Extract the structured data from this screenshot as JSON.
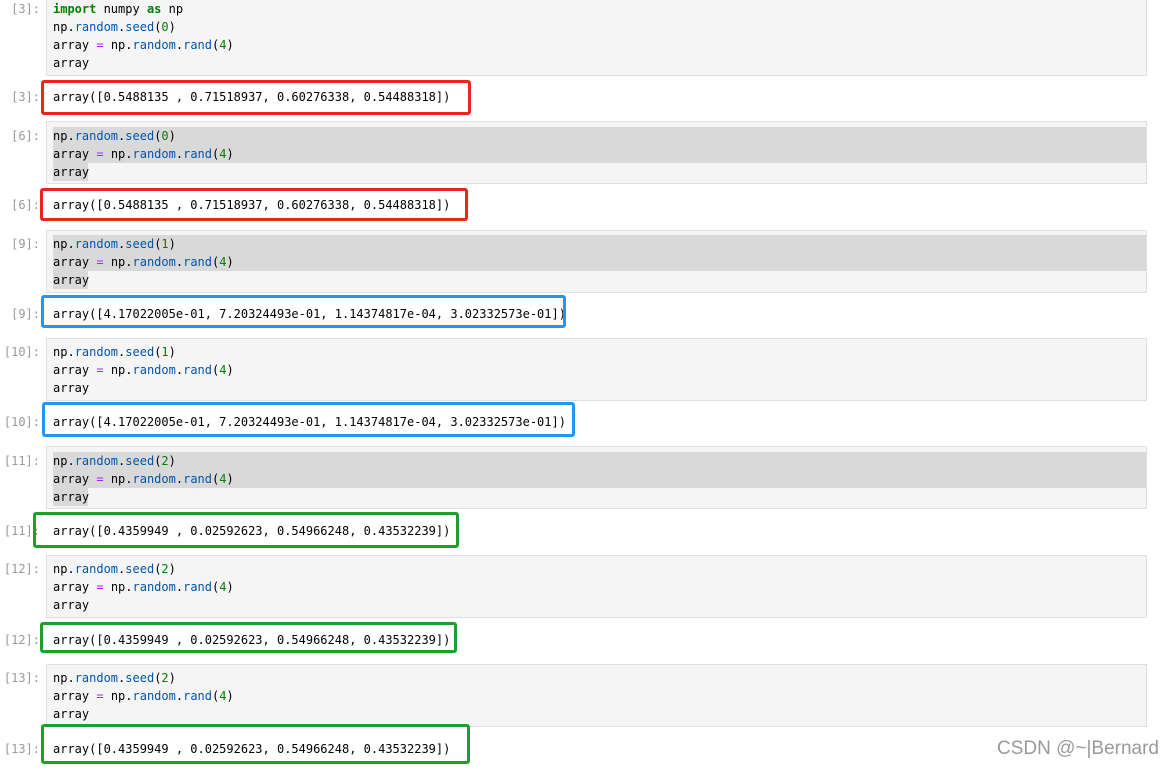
{
  "cells": [
    {
      "in_prompt": "[3]:",
      "out_prompt": "[3]:",
      "lines": [
        "import numpy as np",
        "np.random.seed(0)",
        "array = np.random.rand(4)",
        "array"
      ],
      "output": "array([0.5488135 , 0.71518937, 0.60276338, 0.54488318])",
      "frame_color": "#e8261c"
    },
    {
      "in_prompt": "[6]:",
      "out_prompt": "[6]:",
      "lines": [
        "np.random.seed(0)",
        "array = np.random.rand(4)",
        "array"
      ],
      "output": "array([0.5488135 , 0.71518937, 0.60276338, 0.54488318])",
      "frame_color": "#e8261c"
    },
    {
      "in_prompt": "[9]:",
      "out_prompt": "[9]:",
      "lines": [
        "np.random.seed(1)",
        "array = np.random.rand(4)",
        "array"
      ],
      "output": "array([4.17022005e-01, 7.20324493e-01, 1.14374817e-04, 3.02332573e-01])",
      "frame_color": "#2196f3"
    },
    {
      "in_prompt": "[10]:",
      "out_prompt": "[10]:",
      "lines": [
        "np.random.seed(1)",
        "array = np.random.rand(4)",
        "array"
      ],
      "output": "array([4.17022005e-01, 7.20324493e-01, 1.14374817e-04, 3.02332573e-01])",
      "frame_color": "#2196f3"
    },
    {
      "in_prompt": "[11]:",
      "out_prompt": "[11]:",
      "lines": [
        "np.random.seed(2)",
        "array = np.random.rand(4)",
        "array"
      ],
      "output": "array([0.4359949 , 0.02592623, 0.54966248, 0.43532239])",
      "frame_color": "#1ea12b"
    },
    {
      "in_prompt": "[12]:",
      "out_prompt": "[12]:",
      "lines": [
        "np.random.seed(2)",
        "array = np.random.rand(4)",
        "array"
      ],
      "output": "array([0.4359949 , 0.02592623, 0.54966248, 0.43532239])",
      "frame_color": "#1ea12b"
    },
    {
      "in_prompt": "[13]:",
      "out_prompt": "[13]:",
      "lines": [
        "np.random.seed(2)",
        "array = np.random.rand(4)",
        "array"
      ],
      "output": "array([0.4359949 , 0.02592623, 0.54966248, 0.43532239])",
      "frame_color": "#1ea12b"
    }
  ],
  "watermark": "CSDN @~|Bernard",
  "colors": {
    "keyword": "#008000",
    "attribute": "#0055aa",
    "number": "#008000",
    "operator": "#aa22ff"
  }
}
